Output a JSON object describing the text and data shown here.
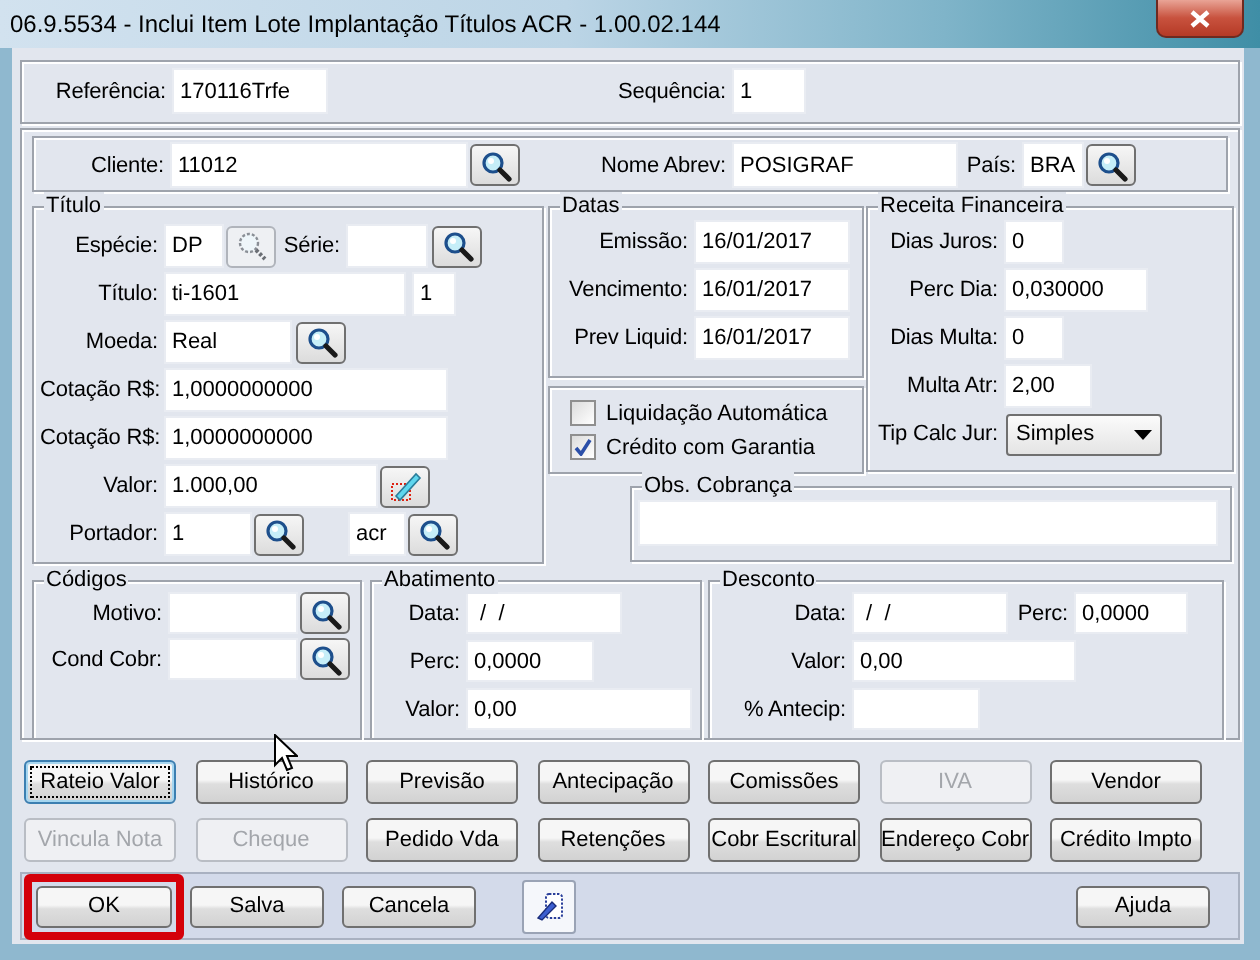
{
  "window": {
    "title": "06.9.5534 - Inclui Item Lote Implantação Títulos ACR - 1.00.02.144"
  },
  "reference": {
    "fields": [
      {
        "label": "Referência:",
        "value": "170116Trfe"
      },
      {
        "label": "Sequência:",
        "value": "1"
      }
    ]
  },
  "client": {
    "fields": [
      {
        "label": "Cliente:",
        "value": "11012",
        "button": {
          "kind": "search",
          "disabled": false
        }
      },
      {
        "label": "Nome Abrev:",
        "value": "POSIGRAF"
      },
      {
        "label": "País:",
        "value": "BRA",
        "button": {
          "kind": "search",
          "disabled": false
        }
      }
    ]
  },
  "titulo": {
    "title": "Título",
    "fields": [
      {
        "label": "Espécie:",
        "value": "DP",
        "button": {
          "kind": "search",
          "disabled": true
        }
      },
      {
        "label": "Série:",
        "button": {
          "kind": "search",
          "disabled": false
        }
      },
      {
        "label": "Título:",
        "value": "ti-1601"
      },
      {
        "value": "1"
      },
      {
        "label": "Moeda:",
        "value": "Real",
        "button": {
          "kind": "search",
          "disabled": false
        }
      },
      {
        "label": "Cotação R$:",
        "value": "1,0000000000"
      },
      {
        "label": "Cotação R$:",
        "value": "1,0000000000"
      },
      {
        "label": "Valor:",
        "value": "1.000,00",
        "button": {
          "kind": "edit",
          "disabled": false
        }
      },
      {
        "label": "Portador:",
        "value": "1",
        "button": {
          "kind": "search",
          "disabled": false
        }
      },
      {
        "value": "acr",
        "button": {
          "kind": "search",
          "disabled": false
        }
      }
    ]
  },
  "datas": {
    "title": "Datas",
    "fields": [
      {
        "label": "Emissão:",
        "value": "16/01/2017"
      },
      {
        "label": "Vencimento:",
        "value": "16/01/2017"
      },
      {
        "label": "Prev Liquid:",
        "value": "16/01/2017"
      }
    ]
  },
  "options": [
    {
      "label": "Liquidação Automática",
      "checked": false
    },
    {
      "label": "Crédito com Garantia",
      "checked": true
    }
  ],
  "receita": {
    "title": "Receita Financeira",
    "fields": [
      {
        "label": "Dias Juros:",
        "value": "0",
        "kind": "input"
      },
      {
        "label": "Perc Dia:",
        "value": "0,030000",
        "kind": "input"
      },
      {
        "label": "Dias Multa:",
        "value": "0",
        "kind": "input"
      },
      {
        "label": "Multa Atr:",
        "value": "2,00",
        "kind": "input"
      },
      {
        "label": "Tip Calc Jur:",
        "value": "Simples",
        "kind": "dropdown"
      }
    ]
  },
  "obs": {
    "title": "Obs. Cobrança"
  },
  "codigos": {
    "title": "Códigos",
    "fields": [
      {
        "label": "Motivo:",
        "button": {
          "kind": "search",
          "disabled": false
        }
      },
      {
        "label": "Cond Cobr:",
        "button": {
          "kind": "search",
          "disabled": false
        }
      }
    ]
  },
  "abatimento": {
    "title": "Abatimento",
    "fields": [
      {
        "label": "Data:",
        "value": " /  /"
      },
      {
        "label": "Perc:",
        "value": "0,0000"
      },
      {
        "label": "Valor:",
        "value": "0,00"
      }
    ]
  },
  "desconto": {
    "title": "Desconto",
    "fields": [
      {
        "label": "Data:",
        "value": " /  /"
      },
      {
        "label": "Perc:",
        "value": "0,0000"
      },
      {
        "label": "Valor:",
        "value": "0,00"
      },
      {
        "label": "% Antecip:"
      }
    ]
  },
  "action_buttons": [
    {
      "label": "Rateio Valor",
      "disabled": false,
      "focused": true
    },
    {
      "label": "Histórico",
      "disabled": false,
      "focused": false
    },
    {
      "label": "Previsão",
      "disabled": false,
      "focused": false
    },
    {
      "label": "Antecipação",
      "disabled": false,
      "focused": false
    },
    {
      "label": "Comissões",
      "disabled": false,
      "focused": false
    },
    {
      "label": "IVA",
      "disabled": true,
      "focused": false
    },
    {
      "label": "Vendor",
      "disabled": false,
      "focused": false
    },
    {
      "label": "Vincula Nota",
      "disabled": true,
      "focused": false
    },
    {
      "label": "Cheque",
      "disabled": true,
      "focused": false
    },
    {
      "label": "Pedido Vda",
      "disabled": false,
      "focused": false
    },
    {
      "label": "Retenções",
      "disabled": false,
      "focused": false
    },
    {
      "label": "Cobr Escritural",
      "disabled": false,
      "focused": false
    },
    {
      "label": "Endereço Cobr",
      "disabled": false,
      "focused": false
    },
    {
      "label": "Crédito Impto",
      "disabled": false,
      "focused": false
    }
  ],
  "footer_buttons": [
    {
      "kind": "text",
      "label": "OK",
      "highlighted": true
    },
    {
      "kind": "text",
      "label": "Salva",
      "highlighted": false
    },
    {
      "kind": "text",
      "label": "Cancela",
      "highlighted": false
    },
    {
      "kind": "icon",
      "highlighted": false
    },
    {
      "kind": "text",
      "label": "Ajuda",
      "highlighted": false
    }
  ]
}
